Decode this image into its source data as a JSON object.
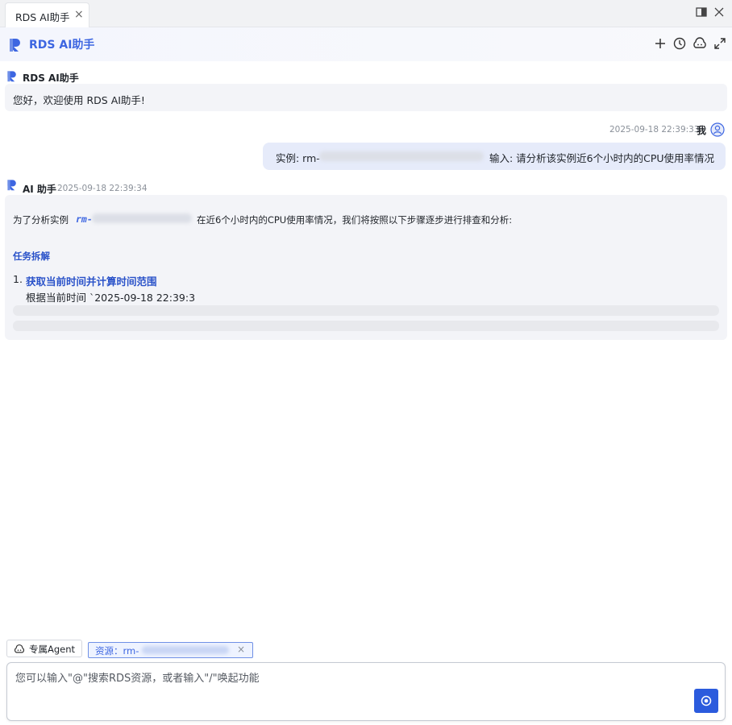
{
  "tab": {
    "title": "RDS AI助手",
    "close": "×"
  },
  "header": {
    "title": "RDS AI助手"
  },
  "greeting": {
    "sender": "RDS AI助手",
    "text": "您好，欢迎使用 RDS AI助手!"
  },
  "user_message": {
    "timestamp": "2025-09-18 22:39:33",
    "sender": "我",
    "prefix": "实例: rm-",
    "suffix": "输入: 请分析该实例近6个小时内的CPU使用率情况"
  },
  "ai_message": {
    "sender": "AI 助手",
    "timestamp": "2025-09-18 22:39:34",
    "intro_prefix": "为了分析实例",
    "instance_code": "rm-",
    "intro_suffix": "在近6个小时内的CPU使用率情况，我们将按照以下步骤逐步进行排查和分析:",
    "section_title": "任务拆解",
    "steps": [
      {
        "number": "1.",
        "title": "获取当前时间并计算时间范围",
        "description": "根据当前时间 `2025-09-18 22:39:3"
      }
    ]
  },
  "agent_button": {
    "label": "专属Agent"
  },
  "resource_chip": {
    "label": "资源：rm-",
    "close": "×"
  },
  "input": {
    "placeholder": "您可以输入\"@\"搜索RDS资源，或者输入\"/\"唤起功能"
  },
  "colors": {
    "accent": "#3d66e1",
    "user_bubble": "#e6ebfa",
    "ai_bubble": "#f3f4f8",
    "send_button": "#2b5bdd"
  },
  "icons": {
    "tab_close": "close-icon",
    "split_view": "split-view-icon",
    "window_close": "close-icon",
    "new_chat": "plus-icon",
    "history": "clock-icon",
    "agent": "cloud-robot-icon",
    "expand": "expand-icon",
    "user_avatar": "user-avatar-icon",
    "send": "send-icon"
  }
}
